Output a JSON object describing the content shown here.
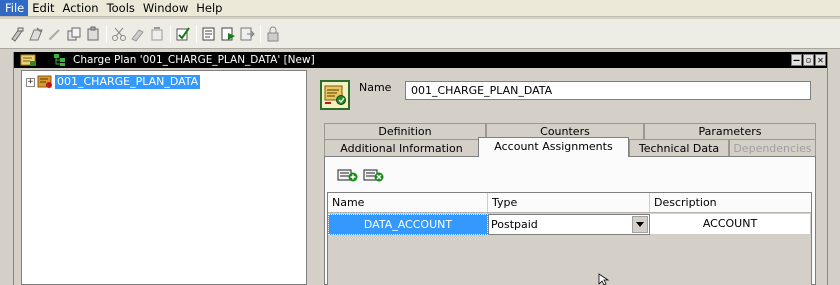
{
  "menubar": {
    "items": [
      "File",
      "Edit",
      "Action",
      "Tools",
      "Window",
      "Help"
    ]
  },
  "toolbar": {
    "icons": [
      "new-icon",
      "open-icon",
      "edit-icon",
      "copy-icon",
      "paste-icon",
      "cut-icon",
      "move-icon",
      "delete-icon",
      "check-icon",
      "report-icon",
      "run-icon",
      "export-icon",
      "lock-icon"
    ]
  },
  "window": {
    "title": "Charge Plan '001_CHARGE_PLAN_DATA' [New]",
    "buttons": {
      "minimize": "–",
      "restore": "▫",
      "close": "✕"
    },
    "title_bg": "#000000"
  },
  "tree": {
    "expander": "+",
    "root_label": "001_CHARGE_PLAN_DATA",
    "selected_color": "#3399ff"
  },
  "details": {
    "name_label": "Name",
    "name_value": "001_CHARGE_PLAN_DATA"
  },
  "tabs": {
    "row1": [
      "Definition",
      "Counters",
      "Parameters"
    ],
    "row2": [
      "Additional Information",
      "Account Assignments",
      "Technical Data",
      "Dependencies"
    ],
    "active": "Account Assignments",
    "disabled": "Dependencies"
  },
  "grid": {
    "buttons": [
      "add-row-icon",
      "remove-row-icon"
    ],
    "columns": [
      "Name",
      "Type",
      "Description"
    ],
    "rows": [
      {
        "name": "DATA_ACCOUNT",
        "type": "Postpaid",
        "description": "ACCOUNT"
      }
    ]
  }
}
